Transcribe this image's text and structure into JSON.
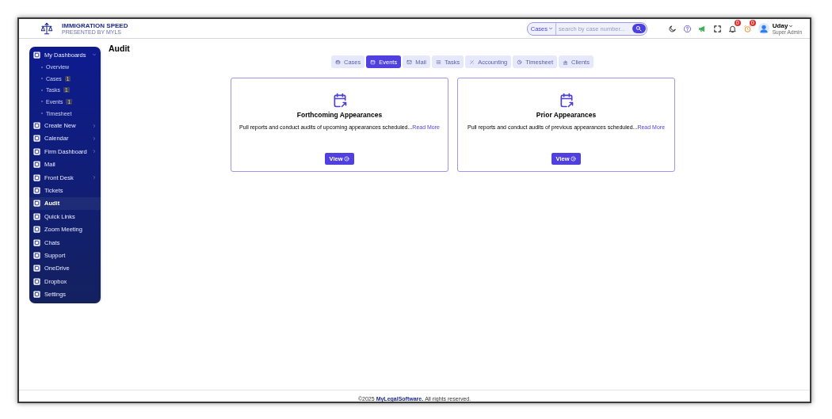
{
  "header": {
    "logo": {
      "title": "IMMIGRATION SPEED",
      "subtitle": "PRESENTED BY MYLS"
    },
    "search": {
      "scope": "Cases",
      "placeholder": "search by case number..."
    },
    "notifications": [
      {
        "kind": "bell",
        "count": "0"
      },
      {
        "kind": "alarm",
        "count": "0"
      }
    ],
    "user": {
      "name": "Uday",
      "role": "Super Admin"
    }
  },
  "sidebar": {
    "items": [
      {
        "label": "My Dashboards",
        "selected": false,
        "expanded": true,
        "children": [
          {
            "label": "Overview"
          },
          {
            "label": "Cases",
            "badge": "1"
          },
          {
            "label": "Tasks",
            "badge": "1"
          },
          {
            "label": "Events",
            "badge": "1"
          },
          {
            "label": "Timesheet"
          }
        ]
      },
      {
        "label": "Create New",
        "selected": false,
        "expanded": false
      },
      {
        "label": "Calendar",
        "selected": false,
        "expanded": false
      },
      {
        "label": "Firm Dashboard",
        "selected": false,
        "expanded": false
      },
      {
        "label": "Mail",
        "selected": false
      },
      {
        "label": "Front Desk",
        "selected": false,
        "expanded": false
      },
      {
        "label": "Tickets",
        "selected": false
      },
      {
        "label": "Audit",
        "selected": true
      },
      {
        "label": "Quick Links",
        "selected": false
      },
      {
        "label": "Zoom Meeting",
        "selected": false
      },
      {
        "label": "Chats",
        "selected": false
      },
      {
        "label": "Support",
        "selected": false
      },
      {
        "label": "OneDrive",
        "selected": false
      },
      {
        "label": "Dropbox",
        "selected": false
      },
      {
        "label": "Settings",
        "selected": false
      }
    ]
  },
  "page": {
    "title": "Audit",
    "tabs": [
      {
        "label": "Cases",
        "selected": false
      },
      {
        "label": "Events",
        "selected": true
      },
      {
        "label": "Mail",
        "selected": false
      },
      {
        "label": "Tasks",
        "selected": false
      },
      {
        "label": "Accounting",
        "selected": false
      },
      {
        "label": "Timesheet",
        "selected": false
      },
      {
        "label": "Clients",
        "selected": false
      }
    ],
    "cards": [
      {
        "title": "Forthcoming Appearances",
        "description": "Pull reports and conduct audits of upcoming appearances scheduled...",
        "link": "Read More",
        "button": "View"
      },
      {
        "title": "Prior Appearances",
        "description": "Pull reports and conduct audits of previous appearances scheduled...",
        "link": "Read More",
        "button": "View"
      }
    ]
  },
  "footer": {
    "prefix": "©2025",
    "brand": "MyLegalSoftware.",
    "suffix": "All rights reserved."
  }
}
